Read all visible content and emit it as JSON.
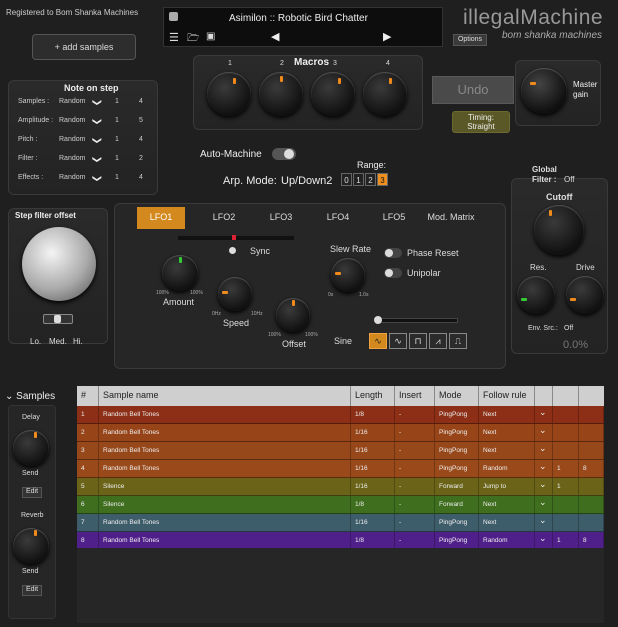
{
  "header": {
    "registered": "Registered to Bom Shanka Machines",
    "add_samples": "+ add samples",
    "preset_name": "Asimilon :: Robotic Bird Chatter",
    "brand": "illegalMachine",
    "brand_sub": "bom shanka machines",
    "options": "Options"
  },
  "macros": {
    "title": "Macros",
    "labels": [
      "1",
      "2",
      "3",
      "4"
    ]
  },
  "undo": {
    "label": "Undo"
  },
  "timing": {
    "label": "Timing:",
    "value": "Straight"
  },
  "master": {
    "label": "Master\ngain"
  },
  "note_on_step": {
    "title": "Note on step",
    "rows": [
      {
        "label": "Samples :",
        "mode": "Random",
        "a": "1",
        "b": "4"
      },
      {
        "label": "Amplitude :",
        "mode": "Random",
        "a": "1",
        "b": "5"
      },
      {
        "label": "Pitch :",
        "mode": "Random",
        "a": "1",
        "b": "4"
      },
      {
        "label": "Filter :",
        "mode": "Random",
        "a": "1",
        "b": "2"
      },
      {
        "label": "Effects :",
        "mode": "Random",
        "a": "1",
        "b": "4"
      }
    ]
  },
  "auto_machine": {
    "label": "Auto-Machine"
  },
  "arp": {
    "label": "Arp. Mode:",
    "value": "Up/Down2"
  },
  "range": {
    "label": "Range:",
    "values": [
      "0",
      "1",
      "2",
      "3"
    ],
    "selected": 3
  },
  "step_filter": {
    "title": "Step filter offset",
    "lo": "Lo.",
    "med": "Med.",
    "hi": "Hi."
  },
  "lfo_tabs": [
    "LFO1",
    "LFO2",
    "LFO3",
    "LFO4",
    "LFO5",
    "Mod. Matrix"
  ],
  "lfo": {
    "sync": "Sync",
    "amount": "Amount",
    "amount_min": "100%",
    "amount_max": "100%",
    "speed": "Speed",
    "speed_min": "0Hz",
    "speed_max": "10Hz",
    "offset": "Offset",
    "offset_min": "100%",
    "offset_max": "100%",
    "slew": "Slew Rate",
    "slew_min": "0s",
    "slew_max": "1.0s",
    "phase_reset": "Phase Reset",
    "unipolar": "Unipolar",
    "wave_label": "Sine"
  },
  "global_filter": {
    "title": "Global\nFilter :",
    "state": "Off",
    "cutoff": "Cutoff",
    "res": "Res.",
    "drive": "Drive",
    "env_src": "Env. Src.:",
    "env_val": "Off",
    "percent": "0.0%"
  },
  "samples_panel": {
    "title": "Samples",
    "delay": "Delay",
    "send1": "Send",
    "edit1": "Edit",
    "reverb": "Reverb",
    "send2": "Send",
    "edit2": "Edit"
  },
  "grid": {
    "headers": [
      "#",
      "Sample name",
      "Length",
      "Insert",
      "Mode",
      "Follow rule",
      "",
      "",
      ""
    ],
    "rows": [
      {
        "n": "1",
        "name": "Random Bell Tones",
        "len": "1/8",
        "ins": "-",
        "mode": "PingPong",
        "rule": "Next",
        "a": "",
        "b": "",
        "color": "#8c2f16"
      },
      {
        "n": "2",
        "name": "Random Bell Tones",
        "len": "1/16",
        "ins": "-",
        "mode": "PingPong",
        "rule": "Next",
        "a": "",
        "b": "",
        "color": "#964418"
      },
      {
        "n": "3",
        "name": "Random Bell Tones",
        "len": "1/16",
        "ins": "-",
        "mode": "PingPong",
        "rule": "Next",
        "a": "",
        "b": "",
        "color": "#96481a"
      },
      {
        "n": "4",
        "name": "Random Bell Tones",
        "len": "1/16",
        "ins": "-",
        "mode": "PingPong",
        "rule": "Random",
        "a": "1",
        "b": "8",
        "color": "#9a4a1a"
      },
      {
        "n": "5",
        "name": "Silence",
        "len": "1/16",
        "ins": "-",
        "mode": "Forward",
        "rule": "Jump to",
        "a": "1",
        "b": "",
        "color": "#6b6418"
      },
      {
        "n": "6",
        "name": "Silence",
        "len": "1/8",
        "ins": "-",
        "mode": "Forward",
        "rule": "Next",
        "a": "",
        "b": "",
        "color": "#3f6e1e"
      },
      {
        "n": "7",
        "name": "Random Bell Tones",
        "len": "1/16",
        "ins": "-",
        "mode": "PingPong",
        "rule": "Next",
        "a": "",
        "b": "",
        "color": "#3e5d6a"
      },
      {
        "n": "8",
        "name": "Random Bell Tones",
        "len": "1/8",
        "ins": "-",
        "mode": "PingPong",
        "rule": "Random",
        "a": "1",
        "b": "8",
        "color": "#50208a"
      }
    ]
  },
  "colors": {
    "accent": "#f0901e",
    "lfo_active": "#d4891e"
  }
}
